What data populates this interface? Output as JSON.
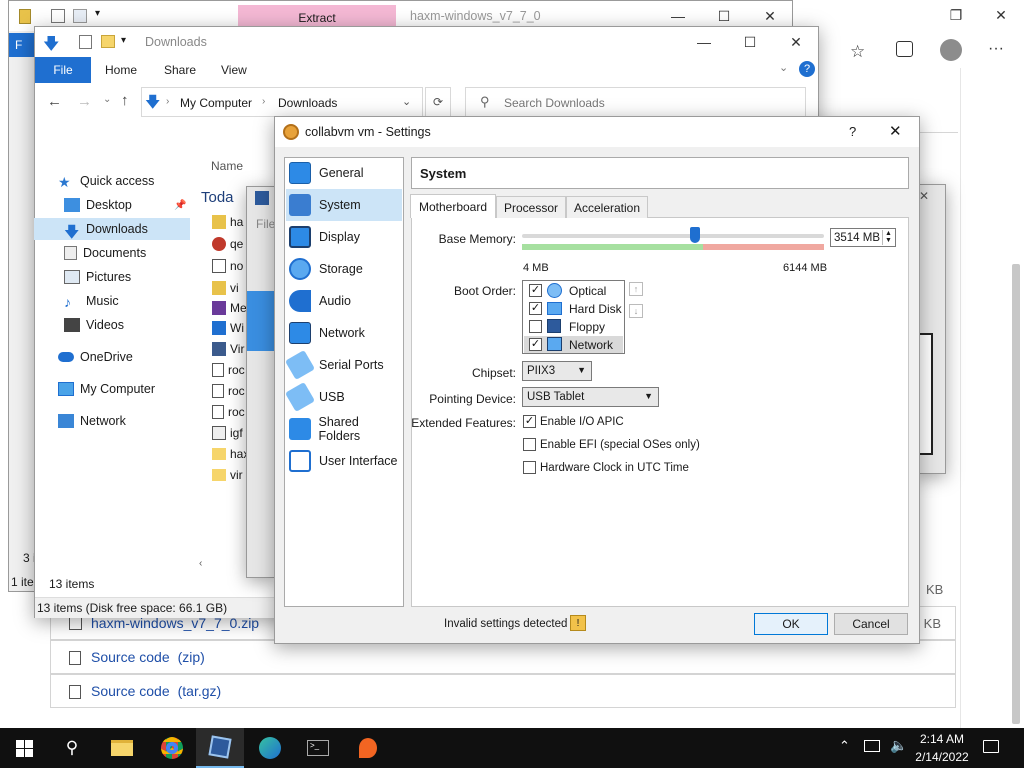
{
  "browser": {
    "toolbar_icons": [
      "favorites-star-icon",
      "collections-icon",
      "profile-icon",
      "more-icon"
    ],
    "downloads_list": [
      {
        "name": "haxm-windows_v7_7_0.zip",
        "size": "KB"
      },
      {
        "name": "Source code",
        "ext": "(zip)",
        "size": "KB"
      },
      {
        "name": "Source code",
        "ext": "(tar.gz)"
      }
    ]
  },
  "explorer_back": {
    "extract_tab": "Extract",
    "title": "haxm-windows_v7_7_0",
    "file_menu": "F",
    "status_left": "3 i",
    "status_bottom": "1 ite"
  },
  "explorer": {
    "title": "Downloads",
    "menu": {
      "file": "File",
      "home": "Home",
      "share": "Share",
      "view": "View"
    },
    "breadcrumb": {
      "root": "My Computer",
      "current": "Downloads"
    },
    "search_placeholder": "Search Downloads",
    "column_name": "Name",
    "group_today": "Toda",
    "nav": {
      "quick_access": "Quick access",
      "desktop": "Desktop",
      "downloads": "Downloads",
      "documents": "Documents",
      "pictures": "Pictures",
      "music": "Music",
      "videos": "Videos",
      "onedrive": "OneDrive",
      "my_computer": "My Computer",
      "network": "Network"
    },
    "files": [
      "ha",
      "qe",
      "no",
      "vi",
      "Me",
      "Wi",
      "Vir",
      "roc",
      "roc",
      "roc",
      "igf",
      "hax",
      "vir"
    ],
    "item_count": "13 items",
    "status": "13 items (Disk free space: 66.1 GB)",
    "file_label": "File"
  },
  "vbox": {
    "title": "collabvm vm - Settings",
    "help": "?",
    "nav": {
      "general": "General",
      "system": "System",
      "display": "Display",
      "storage": "Storage",
      "audio": "Audio",
      "network": "Network",
      "serial_ports": "Serial Ports",
      "usb": "USB",
      "shared_folders": "Shared Folders",
      "user_interface": "User Interface"
    },
    "page_title": "System",
    "tabs": {
      "motherboard": "Motherboard",
      "processor": "Processor",
      "acceleration": "Acceleration"
    },
    "base_memory_label": "Base Memory:",
    "base_memory_value": "3514 MB",
    "memory_fraction": 0.572,
    "memory_min": "4 MB",
    "memory_max": "6144 MB",
    "boot_order_label": "Boot Order:",
    "boot_items": [
      {
        "label": "Optical",
        "checked": "✓"
      },
      {
        "label": "Hard Disk",
        "checked": "✓"
      },
      {
        "label": "Floppy",
        "checked": ""
      },
      {
        "label": "Network",
        "checked": "✓"
      }
    ],
    "chipset_label": "Chipset:",
    "chipset_value": "PIIX3",
    "pointing_label": "Pointing Device:",
    "pointing_value": "USB Tablet",
    "extended_label": "Extended Features:",
    "features": [
      {
        "label": "Enable I/O APIC",
        "checked": "✓"
      },
      {
        "label": "Enable EFI (special OSes only)",
        "checked": ""
      },
      {
        "label": "Hardware Clock in UTC Time",
        "checked": ""
      }
    ],
    "invalid_settings": "Invalid settings detected",
    "ok": "OK",
    "cancel": "Cancel",
    "bg_dialog_text": "File"
  },
  "taskbar": {
    "time": "2:14 AM",
    "date": "2/14/2022"
  },
  "colors": {
    "accent": "#1f6fd0",
    "taskbar": "#101010",
    "selection": "#cce4f7"
  }
}
